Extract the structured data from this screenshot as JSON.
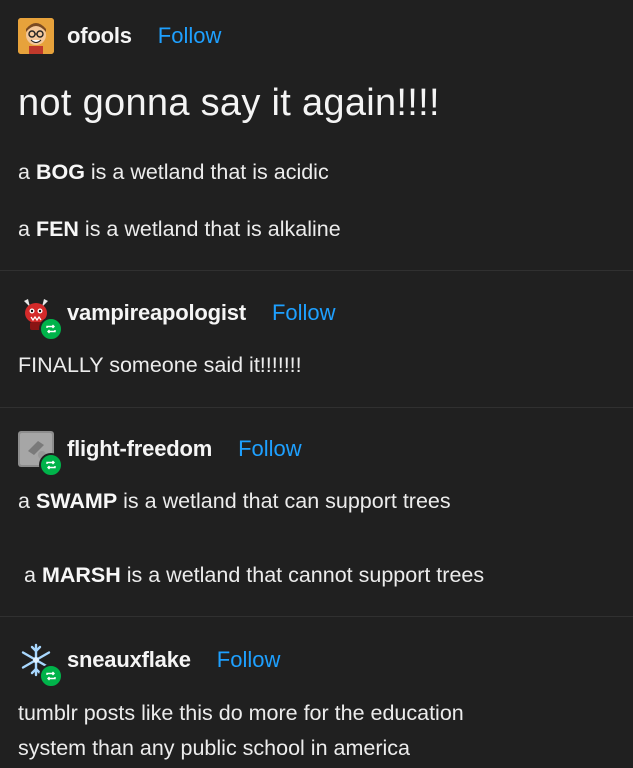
{
  "posts": [
    {
      "username": "ofools",
      "follow_label": "Follow",
      "avatar_icon": "cartoon-face-avatar",
      "title": "not gonna say it again!!!!",
      "lines": [
        {
          "prefix": "a ",
          "bold": "BOG",
          "suffix": " is a wetland that is acidic"
        },
        {
          "prefix": "a ",
          "bold": "FEN",
          "suffix": " is a wetland that is alkaline"
        }
      ]
    },
    {
      "username": "vampireapologist",
      "follow_label": "Follow",
      "avatar_icon": "red-creature-avatar",
      "reblog_icon": "reblog-icon",
      "text": "FINALLY someone said it!!!!!!!"
    },
    {
      "username": "flight-freedom",
      "follow_label": "Follow",
      "avatar_icon": "gray-photo-avatar",
      "reblog_icon": "reblog-icon",
      "lines": [
        {
          "prefix": "a ",
          "bold": "SWAMP",
          "suffix": " is a wetland that can support trees"
        },
        {
          "prefix": "a ",
          "bold": "MARSH",
          "suffix": " is a wetland that cannot support trees"
        }
      ]
    },
    {
      "username": "sneauxflake",
      "follow_label": "Follow",
      "avatar_icon": "snowflake-avatar",
      "reblog_icon": "reblog-icon",
      "lines": [
        "tumblr posts like this do more for the education",
        "system than any public school in america"
      ]
    }
  ],
  "colors": {
    "background": "#202020",
    "follow": "#1ea0ff",
    "reblog_badge": "#00b34a"
  }
}
